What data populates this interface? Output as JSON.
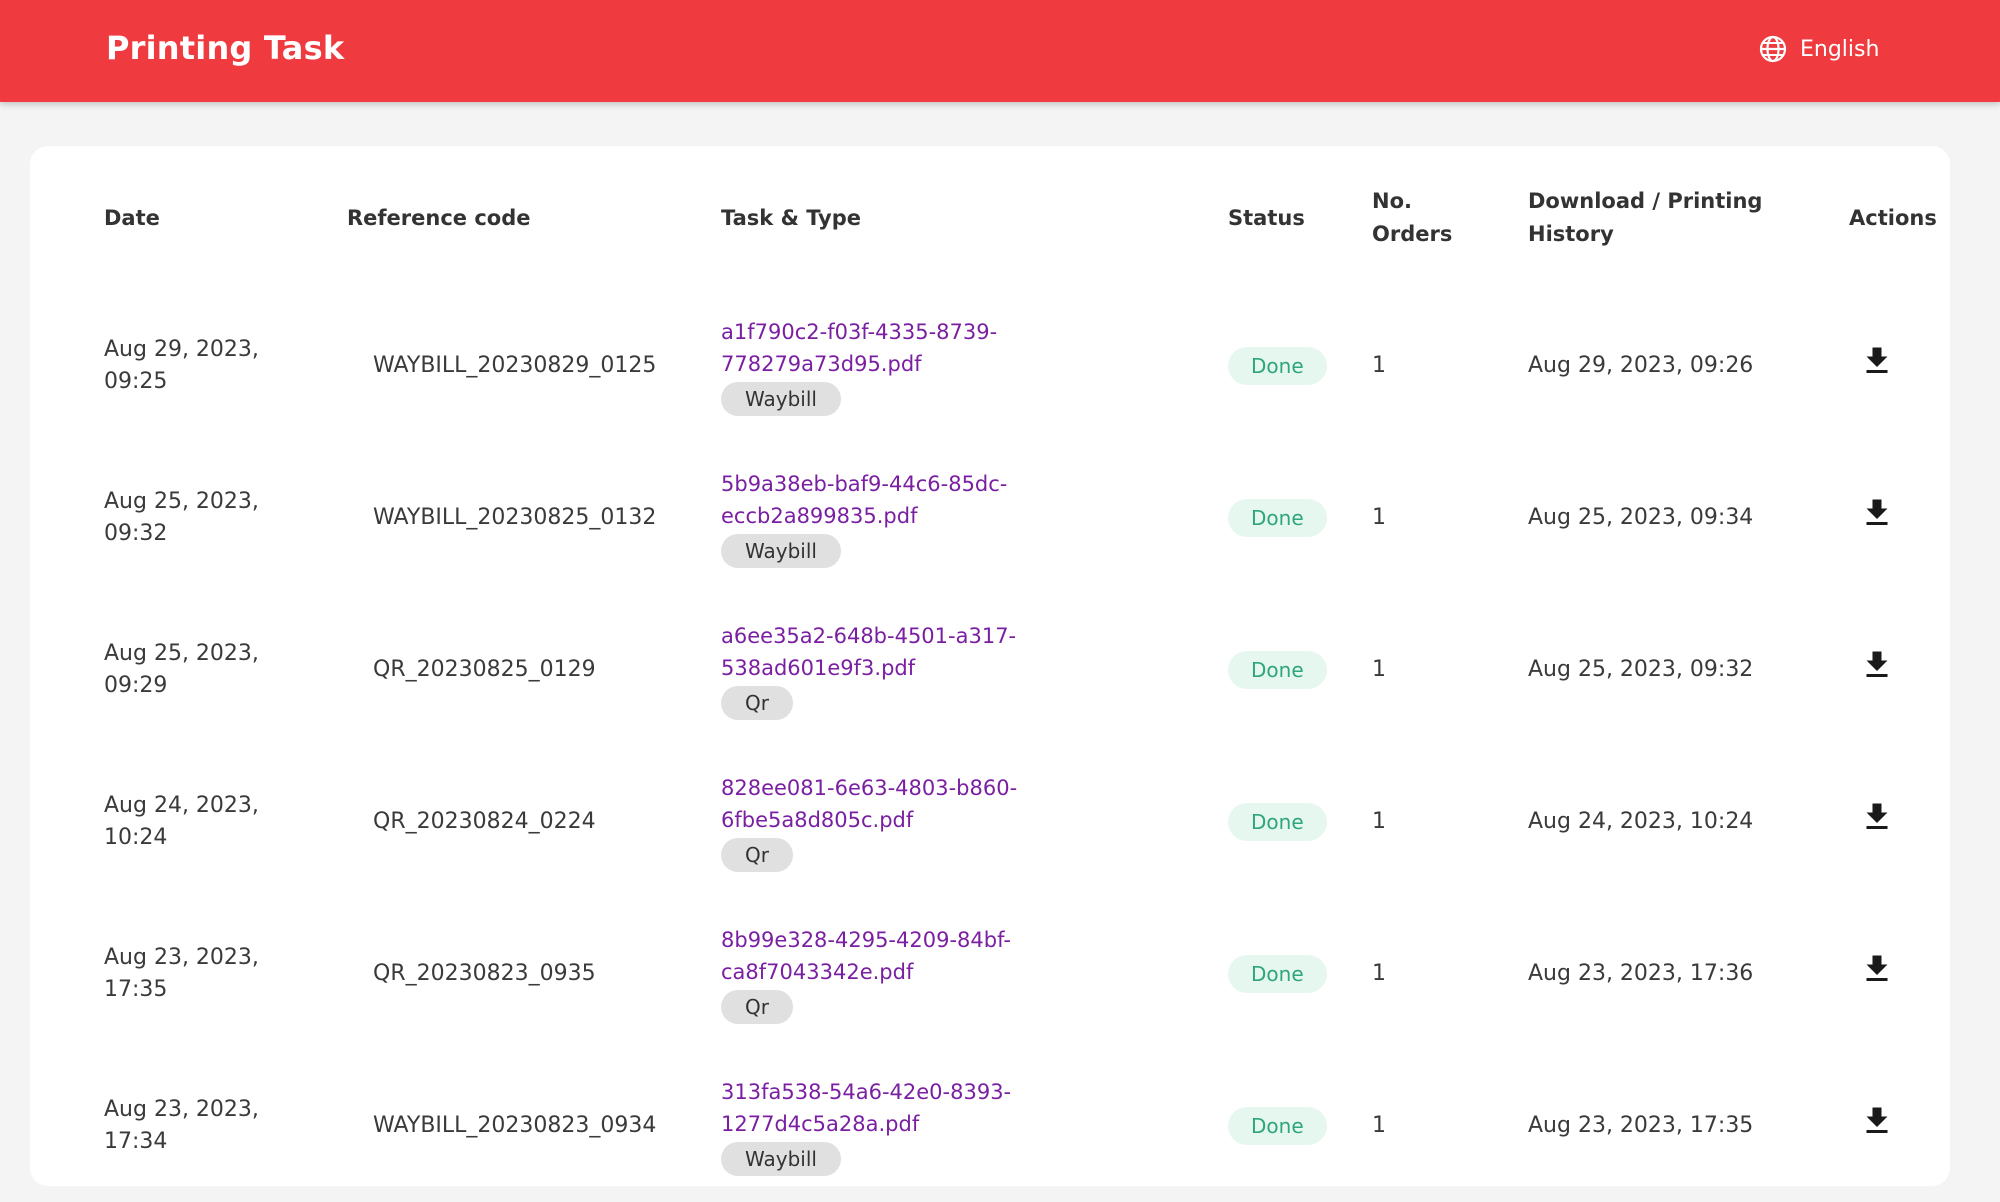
{
  "header": {
    "title": "Printing Task",
    "language_label": "English",
    "language_icon": "globe-icon",
    "background_color": "#ef3b3f"
  },
  "table": {
    "columns": {
      "date": "Date",
      "reference_code": "Reference code",
      "task_type": "Task & Type",
      "status": "Status",
      "no_orders_line1": "No.",
      "no_orders_line2": "Orders",
      "history_line1": "Download / Printing",
      "history_line2": "History",
      "actions": "Actions"
    },
    "rows": [
      {
        "date_line1": "Aug 29, 2023,",
        "date_line2": "09:25",
        "reference_code": "WAYBILL_20230829_0125",
        "task_line1": "a1f790c2-f03f-4335-8739-",
        "task_line2": "778279a73d95.pdf",
        "type": "Waybill",
        "status": "Done",
        "orders": "1",
        "history": "Aug 29, 2023, 09:26",
        "action_icon": "download-icon"
      },
      {
        "date_line1": "Aug 25, 2023,",
        "date_line2": "09:32",
        "reference_code": "WAYBILL_20230825_0132",
        "task_line1": "5b9a38eb-baf9-44c6-85dc-",
        "task_line2": "eccb2a899835.pdf",
        "type": "Waybill",
        "status": "Done",
        "orders": "1",
        "history": "Aug 25, 2023, 09:34",
        "action_icon": "download-icon"
      },
      {
        "date_line1": "Aug 25, 2023,",
        "date_line2": "09:29",
        "reference_code": "QR_20230825_0129",
        "task_line1": "a6ee35a2-648b-4501-a317-",
        "task_line2": "538ad601e9f3.pdf",
        "type": "Qr",
        "status": "Done",
        "orders": "1",
        "history": "Aug 25, 2023, 09:32",
        "action_icon": "download-icon"
      },
      {
        "date_line1": "Aug 24, 2023,",
        "date_line2": "10:24",
        "reference_code": "QR_20230824_0224",
        "task_line1": "828ee081-6e63-4803-b860-",
        "task_line2": "6fbe5a8d805c.pdf",
        "type": "Qr",
        "status": "Done",
        "orders": "1",
        "history": "Aug 24, 2023, 10:24",
        "action_icon": "download-icon"
      },
      {
        "date_line1": "Aug 23, 2023,",
        "date_line2": "17:35",
        "reference_code": "QR_20230823_0935",
        "task_line1": "8b99e328-4295-4209-84bf-",
        "task_line2": "ca8f7043342e.pdf",
        "type": "Qr",
        "status": "Done",
        "orders": "1",
        "history": "Aug 23, 2023, 17:36",
        "action_icon": "download-icon"
      },
      {
        "date_line1": "Aug 23, 2023,",
        "date_line2": "17:34",
        "reference_code": "WAYBILL_20230823_0934",
        "task_line1": "313fa538-54a6-42e0-8393-",
        "task_line2": "1277d4c5a28a.pdf",
        "type": "Waybill",
        "status": "Done",
        "orders": "1",
        "history": "Aug 23, 2023, 17:35",
        "action_icon": "download-icon"
      }
    ]
  },
  "colors": {
    "link": "#7b1fa2",
    "status_done_text": "#2ea67a",
    "status_done_bg": "#e6f7ef",
    "chip_bg": "#e0e0e0"
  }
}
